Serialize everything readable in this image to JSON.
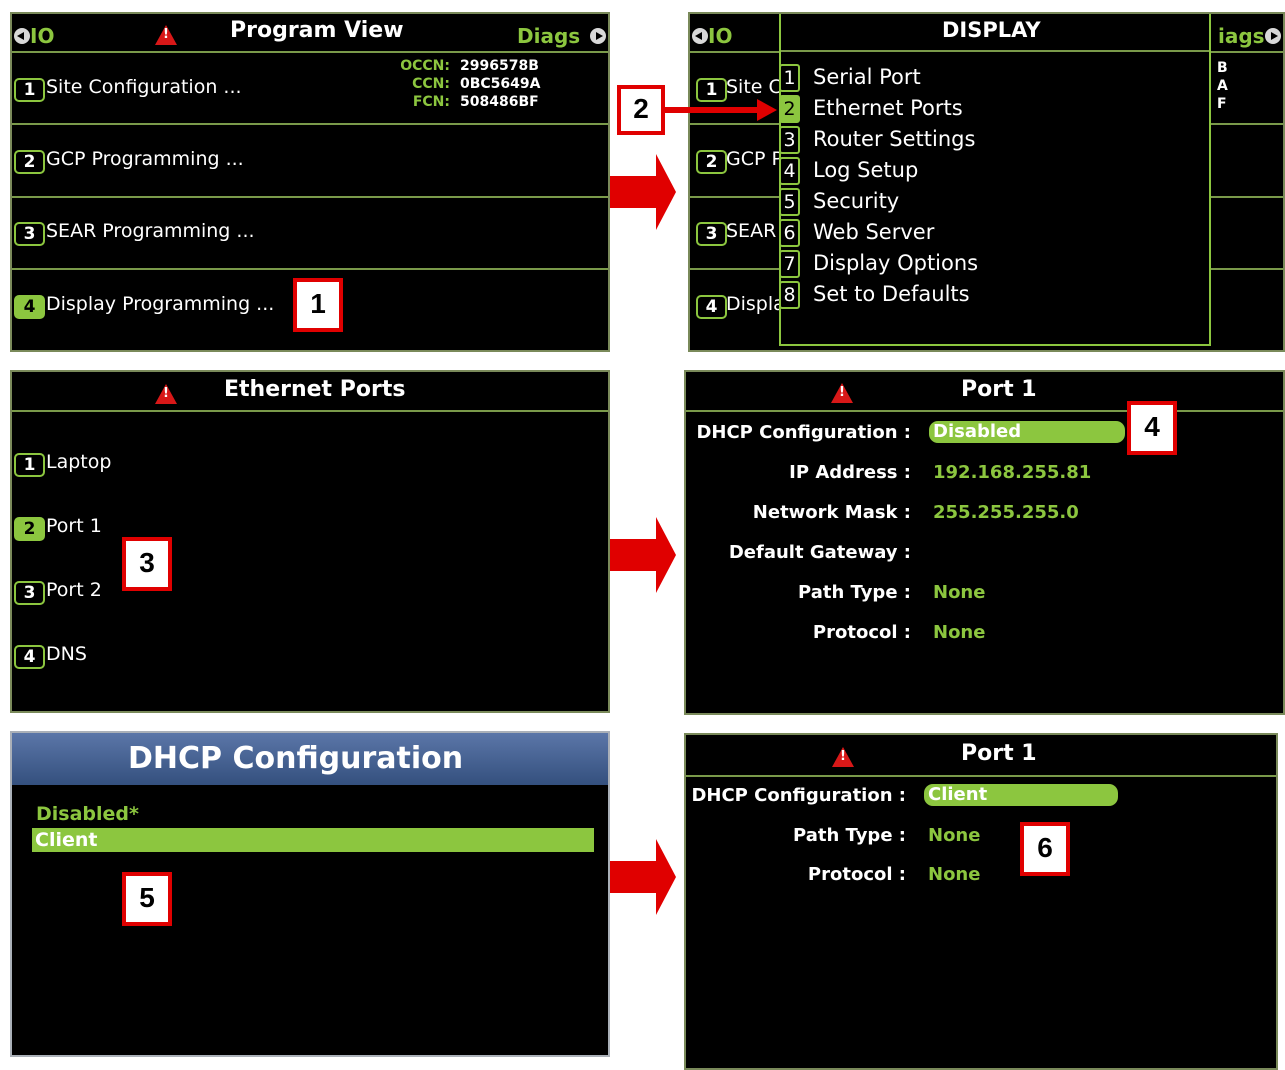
{
  "panel1": {
    "left_nav": "IO",
    "right_nav": "Diags",
    "title": "Program View",
    "occn_label": "OCCN:",
    "occn_value": "2996578B",
    "ccn_label": "CCN:",
    "ccn_value": "0BC5649A",
    "fcn_label": "FCN:",
    "fcn_value": "508486BF",
    "items": [
      {
        "num": "1",
        "label": "Site Configuration ..."
      },
      {
        "num": "2",
        "label": "GCP Programming ..."
      },
      {
        "num": "3",
        "label": "SEAR Programming ..."
      },
      {
        "num": "4",
        "label": "Display Programming ..."
      }
    ]
  },
  "panel2": {
    "left_nav": "IO",
    "right_nav": "iags",
    "title": "DISPLAY",
    "bg_items": [
      {
        "num": "1",
        "label": "Site C"
      },
      {
        "num": "2",
        "label": "GCP P"
      },
      {
        "num": "3",
        "label": "SEAR"
      },
      {
        "num": "4",
        "label": "Displa"
      }
    ],
    "right_codes": [
      "B",
      "A",
      "F"
    ],
    "menu": [
      {
        "num": "1",
        "label": "Serial Port"
      },
      {
        "num": "2",
        "label": "Ethernet Ports"
      },
      {
        "num": "3",
        "label": "Router Settings"
      },
      {
        "num": "4",
        "label": "Log Setup"
      },
      {
        "num": "5",
        "label": "Security"
      },
      {
        "num": "6",
        "label": "Web Server"
      },
      {
        "num": "7",
        "label": "Display Options"
      },
      {
        "num": "8",
        "label": "Set to Defaults"
      }
    ]
  },
  "panel3": {
    "title": "Ethernet Ports",
    "items": [
      {
        "num": "1",
        "label": "Laptop"
      },
      {
        "num": "2",
        "label": "Port 1"
      },
      {
        "num": "3",
        "label": "Port 2"
      },
      {
        "num": "4",
        "label": "DNS"
      }
    ]
  },
  "panel4": {
    "title": "Port 1",
    "dhcp_label": "DHCP Configuration :",
    "dhcp_value": "Disabled",
    "ip_label": "IP Address :",
    "ip_value": "192.168.255.81",
    "mask_label": "Network Mask :",
    "mask_value": "255.255.255.0",
    "gateway_label": "Default Gateway :",
    "path_label": "Path Type :",
    "path_value": "None",
    "protocol_label": "Protocol :",
    "protocol_value": "None"
  },
  "panel5": {
    "title": "DHCP Configuration",
    "options": [
      "Disabled*",
      "Client"
    ]
  },
  "panel6": {
    "title": "Port 1",
    "dhcp_label": "DHCP Configuration :",
    "dhcp_value": "Client",
    "path_label": "Path Type :",
    "path_value": "None",
    "protocol_label": "Protocol :",
    "protocol_value": "None"
  },
  "callouts": [
    "1",
    "2",
    "3",
    "4",
    "5",
    "6"
  ],
  "colors": {
    "accent_green": "#8cc63f",
    "callout_red": "#e00000",
    "warning_red": "#d81818",
    "dialog_header_blue": "#3f5a8a"
  }
}
